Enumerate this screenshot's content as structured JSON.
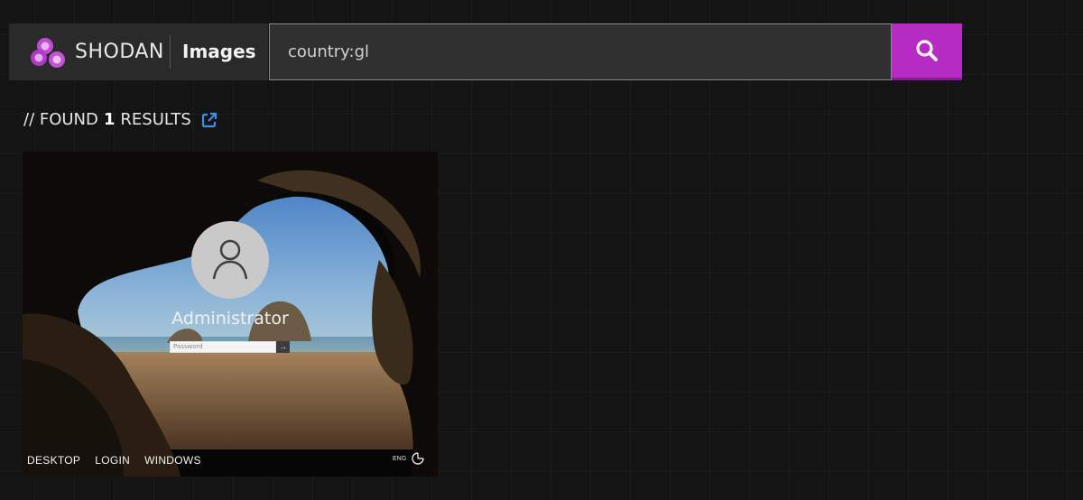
{
  "header": {
    "logo_text": "SHODAN",
    "section": "Images",
    "search": {
      "value": "country:gl",
      "placeholder": ""
    },
    "search_button_icon": "search-icon",
    "accent_color": "#b62cc2"
  },
  "results": {
    "prefix": "// FOUND",
    "count": "1",
    "suffix": "RESULTS",
    "link_icon": "external-link-icon"
  },
  "card": {
    "username": "Administrator",
    "password_placeholder": "Password",
    "submit_arrow": "→",
    "tags": [
      "DESKTOP",
      "LOGIN",
      "WINDOWS"
    ],
    "language": "ENG",
    "power_icon": "ease-of-access-icon"
  }
}
